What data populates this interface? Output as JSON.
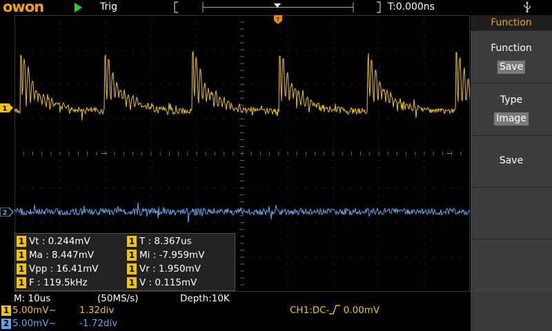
{
  "brand": {
    "name": "OWON",
    "color": "#f2a500"
  },
  "top": {
    "trig_status": "Trig",
    "time_offset": "T:0.000ns"
  },
  "colors": {
    "ch1": "#f2c500",
    "ch2": "#5aa8f0",
    "menu_accent": "#f2a500"
  },
  "channels": [
    {
      "id": "1",
      "marker": "1"
    },
    {
      "id": "2",
      "marker": "2"
    }
  ],
  "measurements": [
    {
      "ch": "1",
      "text": "Vt : 0.244mV"
    },
    {
      "ch": "1",
      "text": "T : 8.367us"
    },
    {
      "ch": "1",
      "text": "Ma : 8.447mV"
    },
    {
      "ch": "1",
      "text": "Mi : -7.959mV"
    },
    {
      "ch": "1",
      "text": "Vpp : 16.41mV"
    },
    {
      "ch": "1",
      "text": "Vr : 1.950mV"
    },
    {
      "ch": "1",
      "text": "F : 119.5kHz"
    },
    {
      "ch": "1",
      "text": "V : 0.115mV"
    }
  ],
  "menu": {
    "title": "Function",
    "sections": [
      {
        "label": "Function",
        "value": "Save"
      },
      {
        "label": "Type",
        "value": "Image"
      },
      {
        "label": "Save",
        "value": ""
      },
      {
        "label": "",
        "value": ""
      },
      {
        "label": "",
        "value": ""
      }
    ]
  },
  "status": {
    "timebase": "M: 10us",
    "sample_rate": "(50MS/s)",
    "depth": "Depth:10K",
    "ch1_scale": "5.00mV~",
    "ch1_pos": "1.32div",
    "ch2_scale": "5.00mV~",
    "ch2_pos": "-1.72div",
    "trigger_prefix": "CH1:DC-",
    "trigger_level": "0.00mV"
  }
}
